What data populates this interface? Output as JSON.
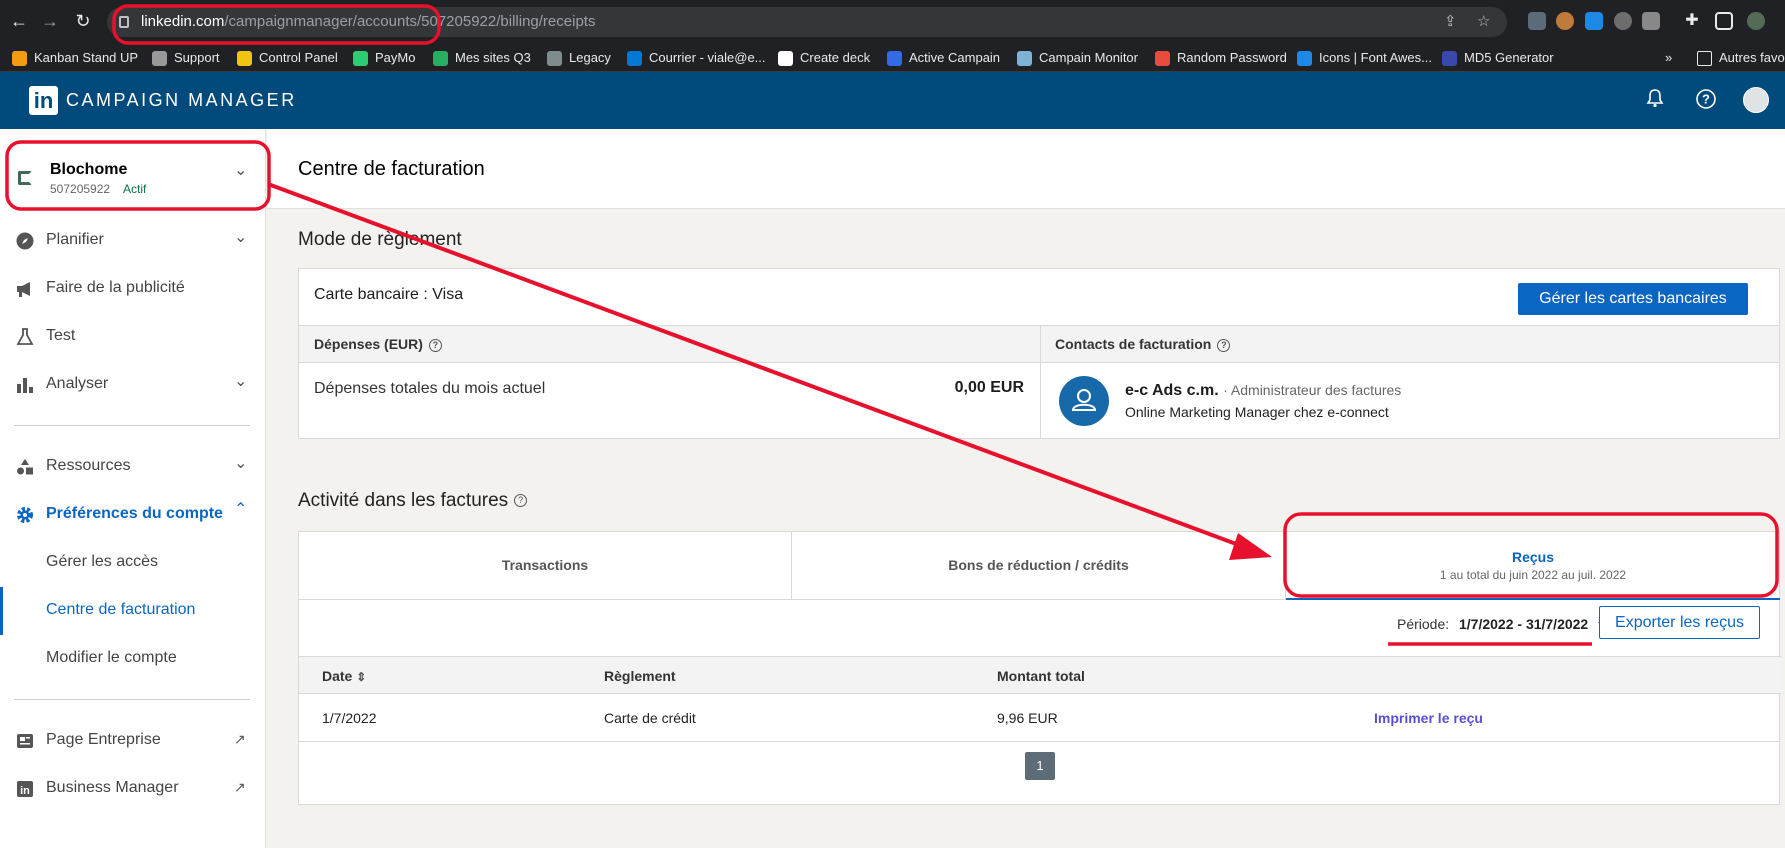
{
  "browser": {
    "url_host": "linkedin.com",
    "url_path": "/campaignmanager/accounts/507205922/billing/receipts",
    "bookmarks": [
      {
        "label": "Kanban Stand UP",
        "color": "#f39c12"
      },
      {
        "label": "Support",
        "color": "#999999"
      },
      {
        "label": "Control Panel",
        "color": "#f1c40f"
      },
      {
        "label": "PayMo",
        "color": "#2ecc71"
      },
      {
        "label": "Mes sites Q3",
        "color": "#27ae60"
      },
      {
        "label": "Legacy",
        "color": "#7f8c8d"
      },
      {
        "label": "Courrier - viale@e...",
        "color": "#0078d4"
      },
      {
        "label": "Create deck",
        "color": "#ffffff"
      },
      {
        "label": "Active Campain",
        "color": "#356ae6"
      },
      {
        "label": "Campain Monitor",
        "color": "#7fb3d5"
      },
      {
        "label": "Random Password",
        "color": "#e74c3c"
      },
      {
        "label": "Icons | Font Awes...",
        "color": "#1e88e5"
      },
      {
        "label": "MD5 Generator",
        "color": "#3949ab"
      }
    ],
    "overflow_label": "»",
    "other_bookmarks": "Autres favo"
  },
  "header": {
    "logo": "in",
    "title": "CAMPAIGN MANAGER"
  },
  "account": {
    "name": "Blochome",
    "id": "507205922",
    "status": "Actif"
  },
  "sidebar": {
    "items": [
      {
        "label": "Planifier",
        "icon": "compass-icon"
      },
      {
        "label": "Faire de la publicité",
        "icon": "megaphone-icon"
      },
      {
        "label": "Test",
        "icon": "flask-icon"
      },
      {
        "label": "Analyser",
        "icon": "bar-chart-icon"
      },
      {
        "label": "Ressources",
        "icon": "shapes-icon"
      },
      {
        "label": "Préférences du compte",
        "icon": "gear-icon"
      },
      {
        "label": "Page Entreprise",
        "icon": "company-page-icon"
      },
      {
        "label": "Business Manager",
        "icon": "linkedin-icon"
      }
    ],
    "sub_items": [
      "Gérer les accès",
      "Centre de facturation",
      "Modifier le compte"
    ]
  },
  "main": {
    "title": "Centre de facturation",
    "payment_section_title": "Mode de règlement",
    "card_label": "Carte bancaire : ",
    "card_value": "Visa",
    "manage_cards_button": "Gérer les cartes bancaires",
    "expenses_header": "Dépenses (EUR)",
    "contacts_header": "Contacts de facturation",
    "expenses_label": "Dépenses totales du mois actuel",
    "expenses_value": "0,00 EUR",
    "contact_name": "e-c Ads c.m.",
    "contact_role": "· Administrateur des factures",
    "contact_title": "Online Marketing Manager chez e-connect",
    "activity_title": "Activité dans les factures",
    "tabs": [
      {
        "label": "Transactions",
        "sub": ""
      },
      {
        "label": "Bons de réduction / crédits",
        "sub": ""
      },
      {
        "label": "Reçus",
        "sub": "1 au total du juin 2022 au juil. 2022"
      }
    ],
    "period_label": "Période:",
    "period_value": "1/7/2022 - 31/7/2022",
    "export_button": "Exporter les reçus",
    "table_headers": [
      "Date",
      "Règlement",
      "Montant total"
    ],
    "rows": [
      {
        "date": "1/7/2022",
        "payment": "Carte de crédit",
        "amount": "9,96 EUR",
        "action": "Imprimer le reçu"
      }
    ],
    "pagination_current": "1"
  },
  "colors": {
    "linkedin_header": "#004a7c",
    "primary": "#0a66c2",
    "annotation": "#e8112d",
    "active_status": "#057642"
  }
}
